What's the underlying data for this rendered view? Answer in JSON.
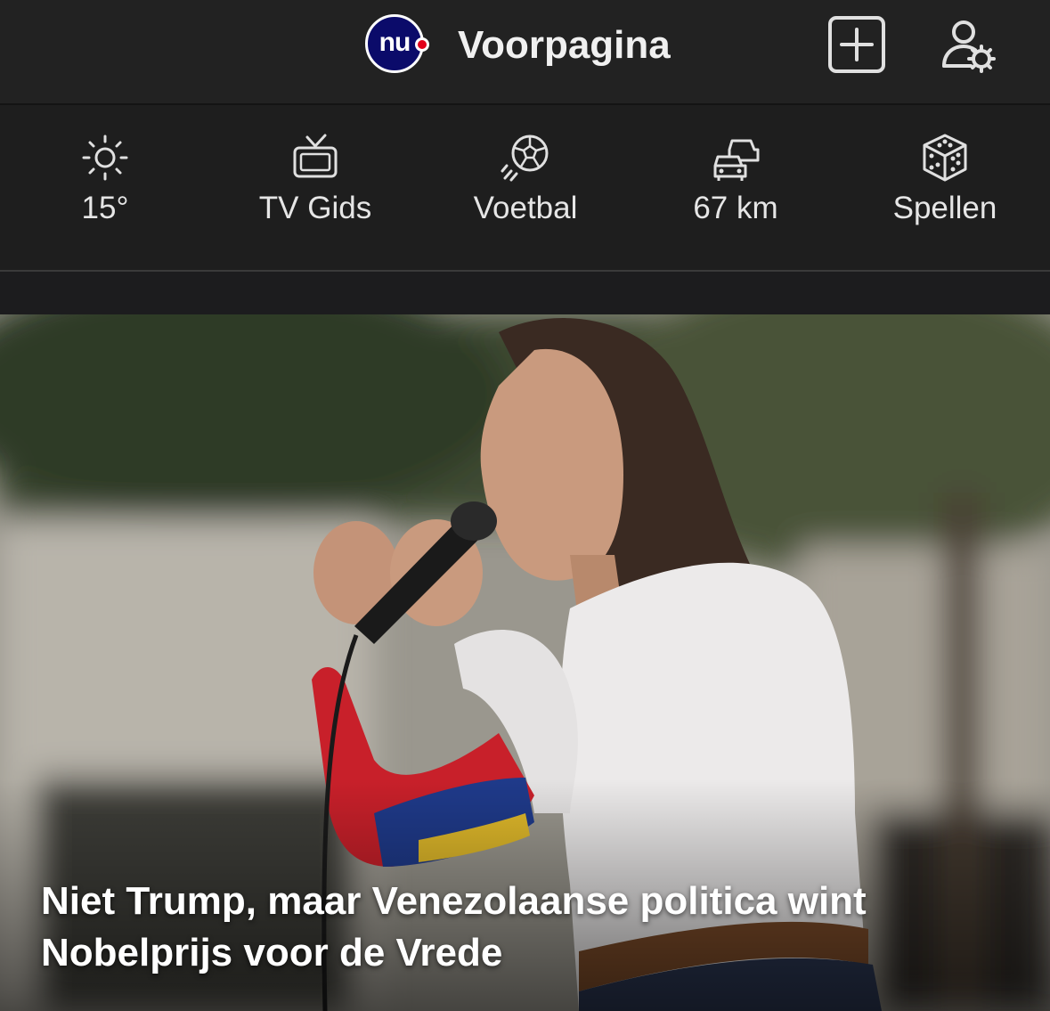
{
  "header": {
    "logo_text": "nu",
    "title": "Voorpagina",
    "add_icon": "plus-square-icon",
    "profile_icon": "user-settings-icon"
  },
  "quickbar": {
    "items": [
      {
        "icon": "sun-icon",
        "label": "15°"
      },
      {
        "icon": "tv-icon",
        "label": "TV Gids"
      },
      {
        "icon": "football-icon",
        "label": "Voetbal"
      },
      {
        "icon": "traffic-cars-icon",
        "label": "67 km"
      },
      {
        "icon": "dice-icon",
        "label": "Spellen"
      }
    ]
  },
  "hero": {
    "headline": "Niet Trump, maar Venezolaanse politica wint Nobelprijs voor de Vrede"
  },
  "colors": {
    "background": "#1c1c1e",
    "logo_blue": "#0b0b6a",
    "logo_red": "#e2001a"
  }
}
